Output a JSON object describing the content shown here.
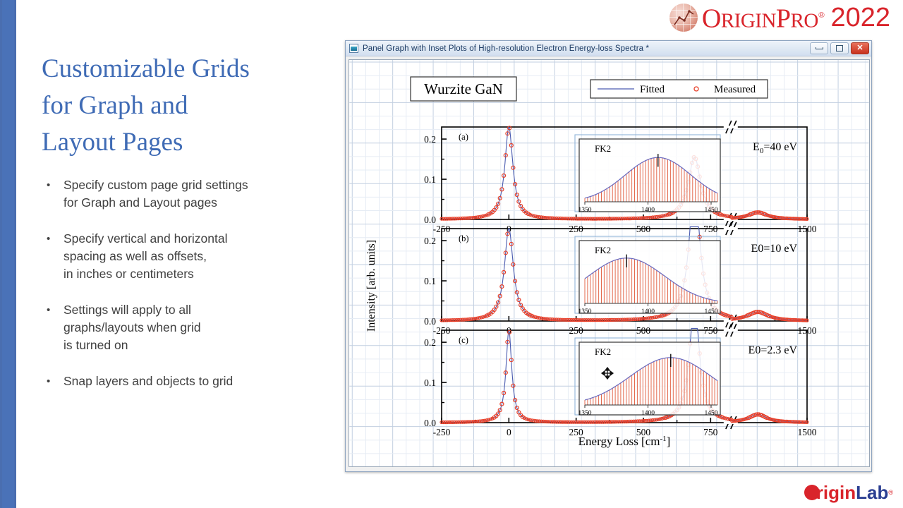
{
  "brand": {
    "name_part1": "O",
    "name_part2": "RIGIN",
    "name_part3": "P",
    "name_part4": "RO",
    "registered": "®",
    "year": "2022",
    "logo_icon": "origin-orb-icon"
  },
  "slide": {
    "title": "Customizable Grids for Graph and Layout Pages",
    "title_lines": [
      "Customizable Grids",
      "for Graph and",
      "Layout Pages"
    ],
    "title_color": "#3f6bb5",
    "bullet_char": "•",
    "bullets": [
      "Specify custom page grid settings\nfor Graph and Layout pages",
      "Specify vertical and horizontal\nspacing as well as offsets,\nin inches or centimeters",
      "Settings will apply to all\ngraphs/layouts when grid\nis turned on",
      "Snap layers and objects to grid"
    ]
  },
  "footer": {
    "logo_origin": "rigin",
    "logo_lab": "Lab",
    "registered": "®"
  },
  "window": {
    "title": "Panel Graph with Inset Plots of High-resolution Electron Energy-loss Spectra *",
    "icon": "graph-window-icon",
    "buttons": {
      "minimize": "minimize-button",
      "maximize": "maximize-button",
      "close": "close-button",
      "close_glyph": "✕"
    }
  },
  "chart_data": {
    "type": "line",
    "title": "Panel Graph with Inset Plots of High-resolution Electron Energy-loss Spectra",
    "sample_label": "Wurzite GaN",
    "xlabel": "Energy Loss [cm",
    "xlabel_sup": "-1",
    "xlabel_close": "]",
    "ylabel": "Intensity [arb. units]",
    "legend": {
      "position": "top-right",
      "entries": [
        {
          "name": "Fitted",
          "marker": "line",
          "color": "#3b4fa0"
        },
        {
          "name": "Measured",
          "marker": "circle",
          "color": "#e8402a"
        }
      ]
    },
    "axis_break_marker": "//",
    "xticks": [
      -250,
      0,
      250,
      500,
      750,
      1500
    ],
    "xtick_labels": [
      "-250",
      "0",
      "250",
      "500",
      "750",
      "1500"
    ],
    "xlim": [
      -250,
      1500
    ],
    "yticks": [
      0.0,
      0.1,
      0.2
    ],
    "ytick_labels": [
      "0.0",
      "0.1",
      "0.2"
    ],
    "ylim": [
      0.0,
      0.23
    ],
    "grid": true,
    "panels": [
      {
        "id": "a",
        "panel_label": "(a)",
        "annotation": "E0=40 eV",
        "annotation_base": "E",
        "annotation_sub": "0",
        "annotation_rest": "=40 eV",
        "peaks": [
          {
            "center": 0,
            "height": 0.23,
            "width": 18
          },
          {
            "center": 690,
            "height": 0.155,
            "width": 28
          },
          {
            "center": 1270,
            "height": 0.017,
            "width": 55
          }
        ],
        "inset": {
          "label": "FK2",
          "xticks": [
            1350,
            1400,
            1450
          ],
          "xtick_labels": [
            "1350",
            "1400",
            "1450"
          ],
          "xlim": [
            1350,
            1455
          ],
          "peak_center": 1408,
          "peak_height": 0.86,
          "peak_width": 26,
          "nbars": 48
        }
      },
      {
        "id": "b",
        "panel_label": "(b)",
        "annotation": "E0=10 eV",
        "annotation_base": "E0",
        "annotation_sub": "",
        "annotation_rest": "=10 eV",
        "peaks": [
          {
            "center": 0,
            "height": 0.23,
            "width": 20
          },
          {
            "center": 690,
            "height": 0.34,
            "width": 24
          },
          {
            "center": 1270,
            "height": 0.022,
            "width": 58
          }
        ],
        "inset": {
          "label": "FK2",
          "xticks": [
            1350,
            1400,
            1450
          ],
          "xtick_labels": [
            "1350",
            "1400",
            "1450"
          ],
          "xlim": [
            1350,
            1455
          ],
          "peak_center": 1383,
          "peak_height": 0.88,
          "peak_width": 30,
          "nbars": 48
        }
      },
      {
        "id": "c",
        "panel_label": "(c)",
        "annotation": "E0=2.3 eV",
        "annotation_base": "E0",
        "annotation_sub": "",
        "annotation_rest": "=2.3 eV",
        "peaks": [
          {
            "center": 0,
            "height": 0.23,
            "width": 13
          },
          {
            "center": 690,
            "height": 0.3,
            "width": 22
          },
          {
            "center": 1270,
            "height": 0.02,
            "width": 50
          }
        ],
        "inset": {
          "label": "FK2",
          "xticks": [
            1350,
            1400,
            1450
          ],
          "xtick_labels": [
            "1350",
            "1400",
            "1450"
          ],
          "xlim": [
            1350,
            1455
          ],
          "peak_center": 1418,
          "peak_height": 0.92,
          "peak_width": 32,
          "nbars": 48
        }
      }
    ]
  },
  "cursor": {
    "type": "move-cursor",
    "panel": "c"
  }
}
